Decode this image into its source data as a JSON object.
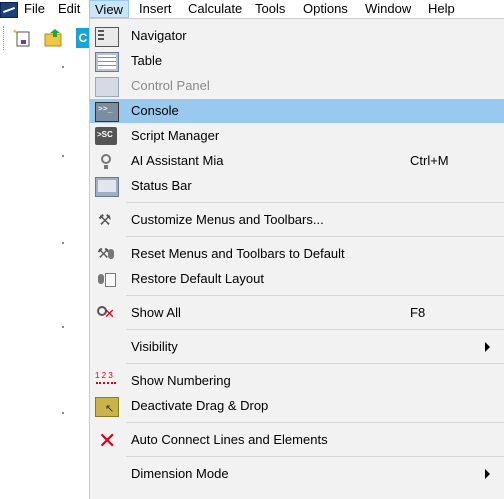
{
  "menubar": {
    "items": [
      {
        "label": "File"
      },
      {
        "label": "Edit"
      },
      {
        "label": "View"
      },
      {
        "label": "Insert"
      },
      {
        "label": "Calculate"
      },
      {
        "label": "Tools"
      },
      {
        "label": "Options"
      },
      {
        "label": "Window"
      },
      {
        "label": "Help"
      }
    ]
  },
  "toolbar": {
    "icons": [
      "new-document-icon",
      "open-folder-icon",
      "c-logo-icon"
    ],
    "c_logo": "C"
  },
  "view_menu": {
    "items": [
      {
        "label": "Navigator",
        "icon": "navigator-icon",
        "enabled": true
      },
      {
        "label": "Table",
        "icon": "table-icon",
        "enabled": true
      },
      {
        "label": "Control Panel",
        "icon": "control-panel-icon",
        "enabled": false
      },
      {
        "label": "Console",
        "icon": "console-icon",
        "enabled": true,
        "highlighted": true
      },
      {
        "label": "Script Manager",
        "icon": "script-manager-icon",
        "enabled": true
      },
      {
        "label": "AI Assistant Mia",
        "icon": "ai-assistant-icon",
        "enabled": true,
        "shortcut": "Ctrl+M"
      },
      {
        "label": "Status Bar",
        "icon": "status-bar-icon",
        "enabled": true
      },
      {
        "label": "Customize Menus and Toolbars...",
        "icon": "customize-tools-icon",
        "enabled": true
      },
      {
        "label": "Reset Menus and Toolbars to Default",
        "icon": "reset-tools-icon",
        "enabled": true
      },
      {
        "label": "Restore Default Layout",
        "icon": "restore-layout-icon",
        "enabled": true
      },
      {
        "label": "Show All",
        "icon": "show-all-icon",
        "enabled": true,
        "shortcut": "F8"
      },
      {
        "label": "Visibility",
        "enabled": true,
        "submenu": true
      },
      {
        "label": "Show Numbering",
        "icon": "numbering-icon",
        "enabled": true
      },
      {
        "label": "Deactivate Drag & Drop",
        "icon": "drag-drop-icon",
        "enabled": true
      },
      {
        "label": "Auto Connect Lines and Elements",
        "icon": "auto-connect-icon",
        "enabled": true
      },
      {
        "label": "Dimension Mode",
        "enabled": true,
        "submenu": true
      }
    ]
  },
  "colors": {
    "menu_background": "#f2f2f2",
    "highlight": "#99c9ef",
    "active_top_menu": "#cce4f7",
    "disabled_text": "#8a8a8a",
    "accent_red": "#d0021b"
  }
}
